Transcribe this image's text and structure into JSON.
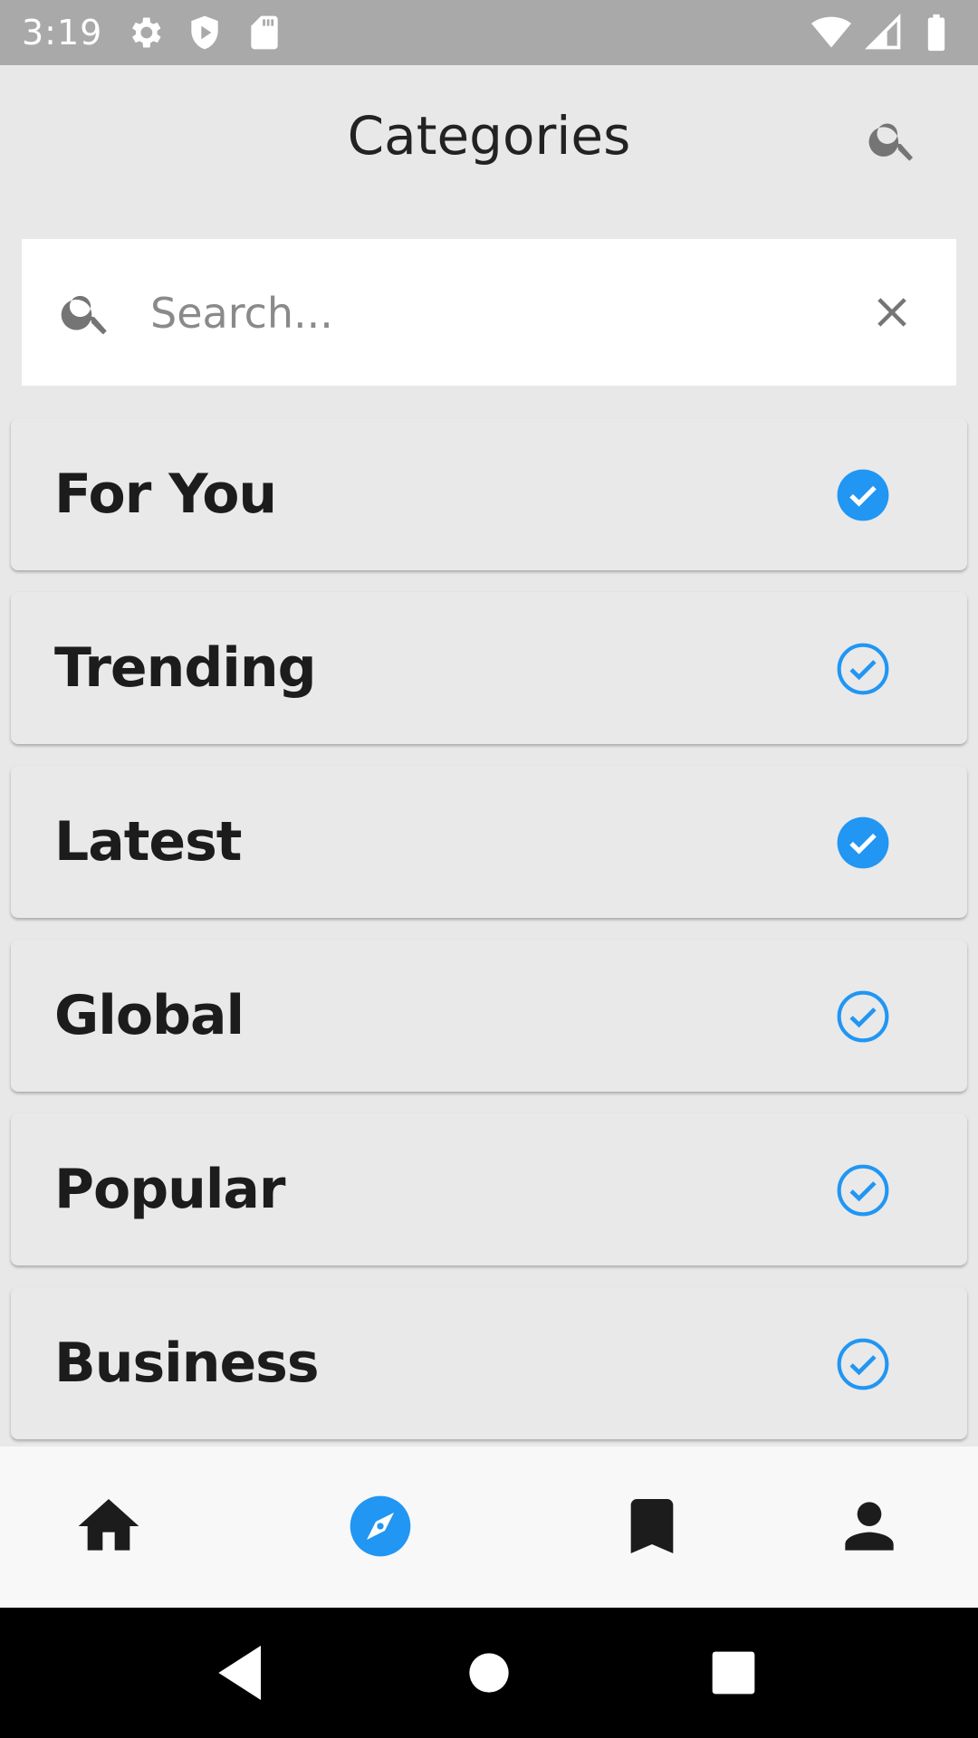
{
  "status_bar": {
    "time": "3:19",
    "left_icons": [
      "settings-icon",
      "shield-play-icon",
      "sd-card-icon"
    ],
    "right_icons": [
      "wifi-icon",
      "signal-icon",
      "battery-icon"
    ]
  },
  "app_bar": {
    "title": "Categories",
    "search_icon": "search-icon"
  },
  "search": {
    "placeholder": "Search...",
    "value": "",
    "leading_icon": "search-icon",
    "trailing_icon": "close-icon"
  },
  "categories": [
    {
      "label": "For You",
      "checked_style": "filled"
    },
    {
      "label": "Trending",
      "checked_style": "outline"
    },
    {
      "label": "Latest",
      "checked_style": "filled"
    },
    {
      "label": "Global",
      "checked_style": "outline"
    },
    {
      "label": "Popular",
      "checked_style": "outline"
    },
    {
      "label": "Business",
      "checked_style": "outline"
    }
  ],
  "bottom_nav": {
    "items": [
      {
        "icon": "home-icon",
        "active": false
      },
      {
        "icon": "compass-icon",
        "active": true
      },
      {
        "icon": "bookmark-icon",
        "active": false
      },
      {
        "icon": "person-icon",
        "active": false
      }
    ]
  },
  "system_nav": [
    "back-icon",
    "home-circle-icon",
    "recents-icon"
  ],
  "colors": {
    "accent": "#2196f3",
    "text_dark": "#1c1c1c",
    "status_bar": "#a9a9a9",
    "background": "#e8e8e8"
  }
}
